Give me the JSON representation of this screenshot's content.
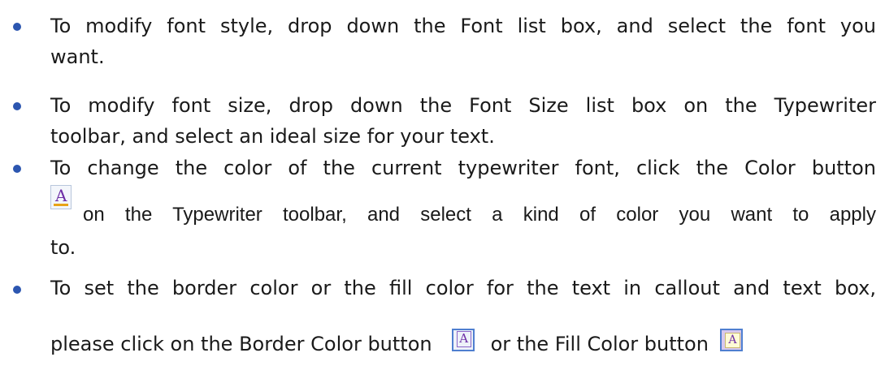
{
  "bullets": [
    {
      "lines": [
        "To modify font style, drop down the Font list box, and select the font you",
        "want."
      ]
    },
    {
      "lines": [
        "To modify font size, drop down the Font Size list box on the Typewriter",
        "toolbar, and select an ideal size for your text."
      ]
    },
    {
      "line1": "To change the color of the current typewriter font, click the Color button",
      "line2_text": "on the Typewriter toolbar, and select a kind of color you want to apply",
      "line3": "to.",
      "icon": "font-color-icon"
    },
    {
      "line1": "To set the border color or the fill color for the text in callout and text box,",
      "line2_part1": "please click on the Border Color button",
      "line2_part2": "or the Fill Color button",
      "icons": [
        "border-color-icon",
        "fill-color-icon"
      ]
    }
  ],
  "icon_glyph": "A",
  "colors": {
    "bullet": "#2c56b0",
    "text": "#1a1a1a",
    "glyph": "#6e2fa6",
    "underline": "#e8a317"
  }
}
